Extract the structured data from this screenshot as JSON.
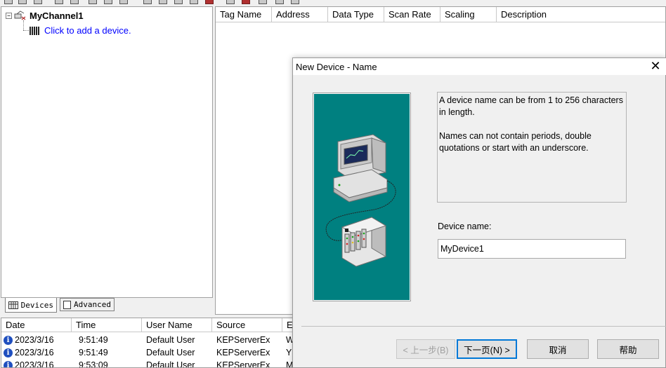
{
  "tree": {
    "channel_label": "MyChannel1",
    "expander_glyph": "−",
    "add_device_link": "Click to add a device."
  },
  "tabs": [
    {
      "label": "Devices",
      "icon": "grid-icon"
    },
    {
      "label": "Advanced",
      "icon": "document-icon"
    }
  ],
  "tag_table": {
    "columns": [
      "Tag Name",
      "Address",
      "Data Type",
      "Scan Rate",
      "Scaling",
      "Description"
    ]
  },
  "event_log": {
    "columns": [
      "Date",
      "Time",
      "User Name",
      "Source",
      "E"
    ],
    "rows": [
      {
        "date": "2023/3/16",
        "time": "9:51:49",
        "user": "Default User",
        "source": "KEPServerEx",
        "event": "W"
      },
      {
        "date": "2023/3/16",
        "time": "9:51:49",
        "user": "Default User",
        "source": "KEPServerEx",
        "event": "Y"
      },
      {
        "date": "2023/3/16",
        "time": "9:53:09",
        "user": "Default User",
        "source": "KEPServerEx",
        "event": "M"
      }
    ]
  },
  "dialog": {
    "title": "New Device - Name",
    "close_glyph": "✕",
    "info_paragraph_1": "A device name can be from 1 to 256 characters in length.",
    "info_paragraph_2": "Names can not contain periods, double quotations or start with an underscore.",
    "field_label": "Device name:",
    "device_name_value": "MyDevice1",
    "buttons": {
      "back": "< 上一步(B)",
      "next": "下一页(N) >",
      "cancel": "取消",
      "help": "帮助"
    }
  },
  "colors": {
    "illustration_bg": "#008080",
    "link": "#0000ff",
    "info_icon": "#1f4fbf",
    "default_button_border": "#0078d7"
  }
}
